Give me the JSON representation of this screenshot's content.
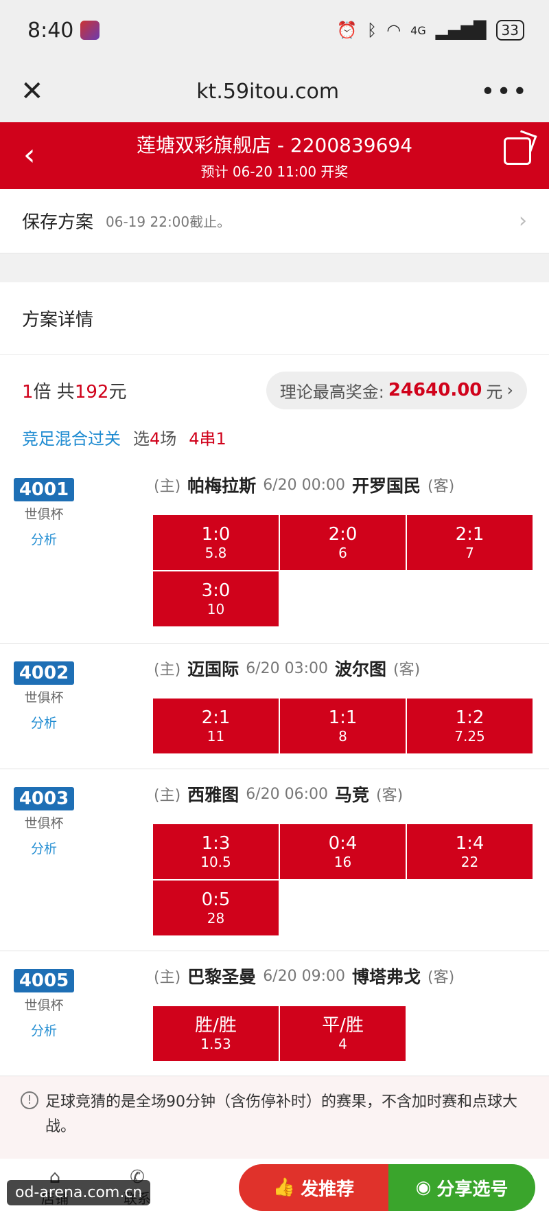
{
  "status_bar": {
    "time": "8:40",
    "network": "4G",
    "battery": "33"
  },
  "browser": {
    "url": "kt.59itou.com"
  },
  "header": {
    "title": "莲塘双彩旗舰店 - 2200839694",
    "subtitle": "预计 06-20 11:00 开奖"
  },
  "save_plan": {
    "label": "保存方案",
    "deadline": "06-19 22:00截止。"
  },
  "detail": {
    "title": "方案详情"
  },
  "summary": {
    "multiplier_num": "1",
    "multiplier_unit": "倍 共",
    "amount": "192",
    "amount_unit": "元",
    "prize_label": "理论最高奖金:",
    "prize_value": "24640.00",
    "prize_unit": "元",
    "play_type": "竞足混合过关",
    "pick_prefix": "选",
    "pick_count": "4",
    "pick_suffix": "场",
    "combo": "4串1"
  },
  "matches": [
    {
      "no": "4001",
      "league": "世俱杯",
      "analysis": "分析",
      "home_tag": "(主)",
      "home": "帕梅拉斯",
      "time": "6/20 00:00",
      "away": "开罗国民",
      "away_tag": "(客)",
      "picks": [
        {
          "score": "1:0",
          "odds": "5.8"
        },
        {
          "score": "2:0",
          "odds": "6"
        },
        {
          "score": "2:1",
          "odds": "7"
        },
        {
          "score": "3:0",
          "odds": "10"
        }
      ]
    },
    {
      "no": "4002",
      "league": "世俱杯",
      "analysis": "分析",
      "home_tag": "(主)",
      "home": "迈国际",
      "time": "6/20 03:00",
      "away": "波尔图",
      "away_tag": "(客)",
      "picks": [
        {
          "score": "2:1",
          "odds": "11"
        },
        {
          "score": "1:1",
          "odds": "8"
        },
        {
          "score": "1:2",
          "odds": "7.25"
        }
      ]
    },
    {
      "no": "4003",
      "league": "世俱杯",
      "analysis": "分析",
      "home_tag": "(主)",
      "home": "西雅图",
      "time": "6/20 06:00",
      "away": "马竞",
      "away_tag": "(客)",
      "picks": [
        {
          "score": "1:3",
          "odds": "10.5"
        },
        {
          "score": "0:4",
          "odds": "16"
        },
        {
          "score": "1:4",
          "odds": "22"
        },
        {
          "score": "0:5",
          "odds": "28"
        }
      ]
    },
    {
      "no": "4005",
      "league": "世俱杯",
      "analysis": "分析",
      "home_tag": "(主)",
      "home": "巴黎圣曼",
      "time": "6/20 09:00",
      "away": "博塔弗戈",
      "away_tag": "(客)",
      "picks": [
        {
          "score": "胜/胜",
          "odds": "1.53"
        },
        {
          "score": "平/胜",
          "odds": "4"
        }
      ]
    }
  ],
  "notice": {
    "text": "足球竞猜的是全场90分钟（含伤停补时）的赛果，不含加时赛和点球大战。"
  },
  "bottom_bar": {
    "home_label": "店铺",
    "contact_label": "联系",
    "recommend_label": "发推荐",
    "share_label": "分享选号"
  },
  "watermark": "od-arena.com.cn",
  "colors": {
    "brand_red": "#d0021b",
    "match_no_blue": "#1e6fb5",
    "link_blue": "#1e8bd1",
    "share_green": "#3aa52c"
  }
}
